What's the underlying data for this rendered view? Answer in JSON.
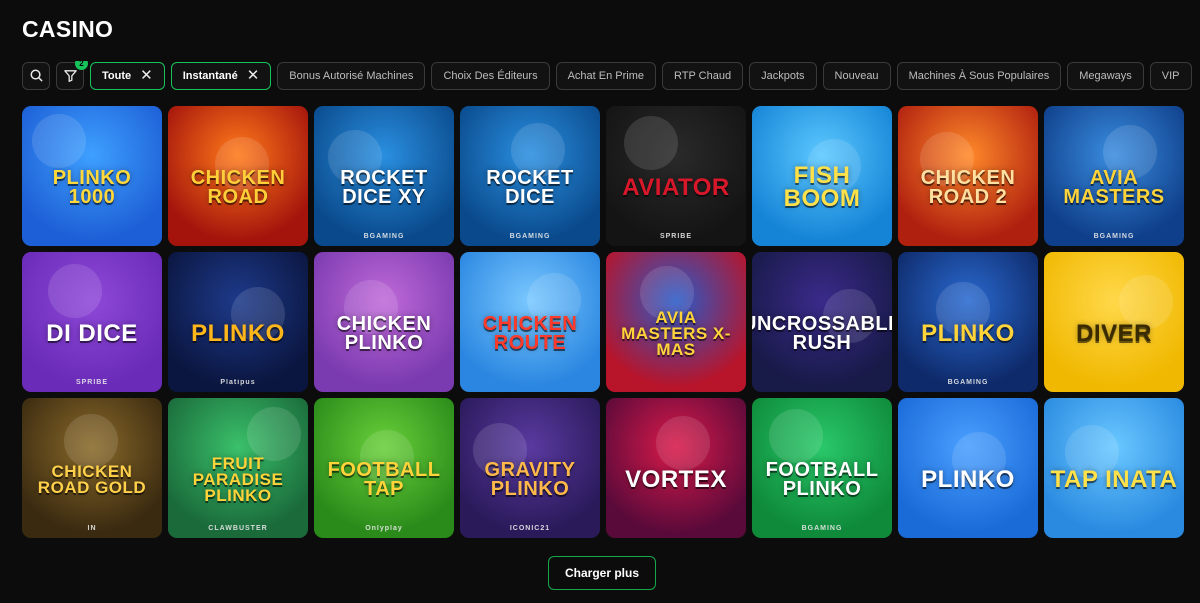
{
  "page": {
    "title": "CASINO"
  },
  "filters": {
    "filter_count": "2",
    "chips": [
      {
        "label": "Toute",
        "active": true
      },
      {
        "label": "Instantané",
        "active": true
      },
      {
        "label": "Bonus Autorisé Machines",
        "active": false
      },
      {
        "label": "Choix Des Éditeurs",
        "active": false
      },
      {
        "label": "Achat En Prime",
        "active": false
      },
      {
        "label": "RTP Chaud",
        "active": false
      },
      {
        "label": "Jackpots",
        "active": false
      },
      {
        "label": "Nouveau",
        "active": false
      },
      {
        "label": "Machines À Sous Populaires",
        "active": false
      },
      {
        "label": "Megaways",
        "active": false
      },
      {
        "label": "VIP",
        "active": false
      }
    ]
  },
  "games": [
    {
      "title": "PLINKO 1000",
      "provider": "",
      "bg1": "#1d5fd6",
      "bg2": "#3ea0ff",
      "text": "#ffd93b"
    },
    {
      "title": "CHICKEN ROAD",
      "provider": "",
      "bg1": "#a4140c",
      "bg2": "#ff7a1a",
      "text": "#ffcf3a"
    },
    {
      "title": "Rocket Dice XY",
      "provider": "BGAMING",
      "bg1": "#0a4a8c",
      "bg2": "#2a8fe0",
      "text": "#ffffff"
    },
    {
      "title": "Rocket Dice",
      "provider": "BGAMING",
      "bg1": "#0a4a8c",
      "bg2": "#2a8fe0",
      "text": "#ffffff"
    },
    {
      "title": "Aviator",
      "provider": "SPRIBE",
      "bg1": "#141414",
      "bg2": "#2a2a2a",
      "text": "#d8182a"
    },
    {
      "title": "FISH BOOM",
      "provider": "",
      "bg1": "#1584d6",
      "bg2": "#5cc8ff",
      "text": "#ffe14a"
    },
    {
      "title": "CHICKEN ROAD 2",
      "provider": "",
      "bg1": "#b0200f",
      "bg2": "#ff8a2a",
      "text": "#ffe0a0"
    },
    {
      "title": "AVIA MASTERS",
      "provider": "BGAMING",
      "bg1": "#0f3f8a",
      "bg2": "#3a8de0",
      "text": "#ffd43a"
    },
    {
      "title": "Di Dice",
      "provider": "SPRIBE",
      "bg1": "#6a2bb8",
      "bg2": "#8e48d8",
      "text": "#ffffff"
    },
    {
      "title": "PLINKO",
      "provider": "Platipus",
      "bg1": "#0b1640",
      "bg2": "#1d3a8a",
      "text": "#ffb61a"
    },
    {
      "title": "CHICKEN PLINKO",
      "provider": "",
      "bg1": "#7a3ab0",
      "bg2": "#c06ad8",
      "text": "#ffffff"
    },
    {
      "title": "CHICKEN ROUTE",
      "provider": "",
      "bg1": "#2a86e0",
      "bg2": "#7ac8ff",
      "text": "#ff3a2a"
    },
    {
      "title": "AVIA MASTERS X-MAS",
      "provider": "",
      "bg1": "#b8142a",
      "bg2": "#2a5ac8",
      "text": "#ffd43a"
    },
    {
      "title": "UNCROSSABLE RUSH",
      "provider": "",
      "bg1": "#181a48",
      "bg2": "#3a2a8a",
      "text": "#ffffff"
    },
    {
      "title": "PLINKO",
      "provider": "BGAMING",
      "bg1": "#0e2a6a",
      "bg2": "#2a6ad0",
      "text": "#ffd43a"
    },
    {
      "title": "DIVER",
      "provider": "",
      "bg1": "#f0b800",
      "bg2": "#ffd84a",
      "text": "#3a2a00"
    },
    {
      "title": "CHICKEN ROAD Gold",
      "provider": "IN",
      "bg1": "#3a2a10",
      "bg2": "#8a6a2a",
      "text": "#ffd14a"
    },
    {
      "title": "FRUIT PARADISE PLINKO",
      "provider": "CLAWBUSTER",
      "bg1": "#1a6a3a",
      "bg2": "#3ac06a",
      "text": "#ffd43a"
    },
    {
      "title": "FOOTBALL TAP",
      "provider": "Onlyplay",
      "bg1": "#2a8a1a",
      "bg2": "#6ad03a",
      "text": "#ffd43a"
    },
    {
      "title": "GRAVITY PLINKO",
      "provider": "ICONIC21",
      "bg1": "#2a1a5a",
      "bg2": "#5a3aa0",
      "text": "#ffb84a"
    },
    {
      "title": "VORTEX",
      "provider": "",
      "bg1": "#5a0a3a",
      "bg2": "#d81a4a",
      "text": "#ffffff"
    },
    {
      "title": "FOOTBALL PLINKO",
      "provider": "BGAMING",
      "bg1": "#0e8a3a",
      "bg2": "#2ac86a",
      "text": "#ffffff"
    },
    {
      "title": "PLINKO",
      "provider": "",
      "bg1": "#1a6ad8",
      "bg2": "#4aa0ff",
      "text": "#ffffff"
    },
    {
      "title": "TAP INATA",
      "provider": "",
      "bg1": "#2a8ae0",
      "bg2": "#6ac8ff",
      "text": "#ffe14a"
    }
  ],
  "load_more": {
    "label": "Charger plus"
  },
  "colors": {
    "accent": "#17c45a",
    "background": "#0c0c0c"
  }
}
